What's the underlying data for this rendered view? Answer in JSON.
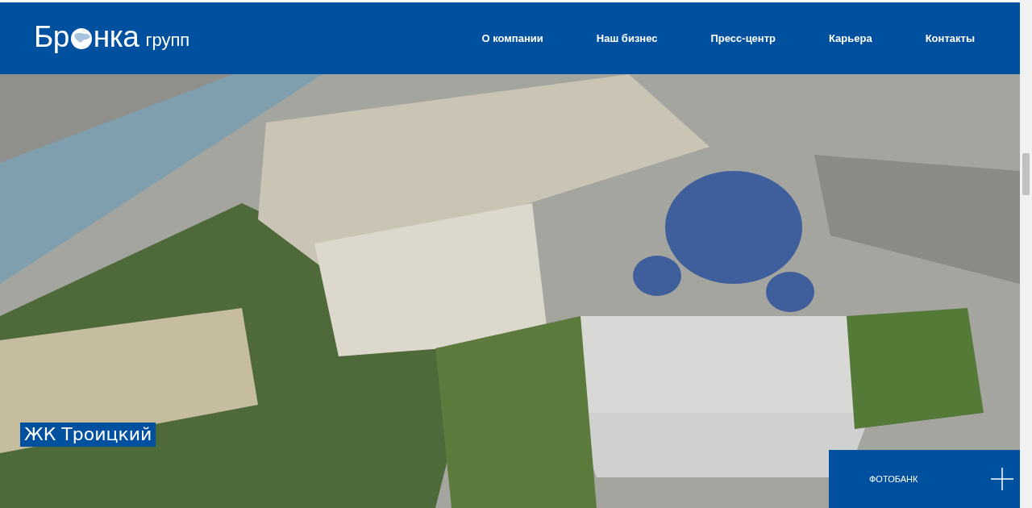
{
  "header": {
    "logo": {
      "part_1": "Бр",
      "part_2": "нка",
      "suffix": "групп"
    },
    "nav": [
      {
        "label": "О компании"
      },
      {
        "label": "Наш бизнес"
      },
      {
        "label": "Пресс-центр"
      },
      {
        "label": "Карьера"
      },
      {
        "label": "Контакты"
      }
    ]
  },
  "hero": {
    "caption": "ЖК Троицкий",
    "photobank_button": "ФОТОБАНК"
  }
}
